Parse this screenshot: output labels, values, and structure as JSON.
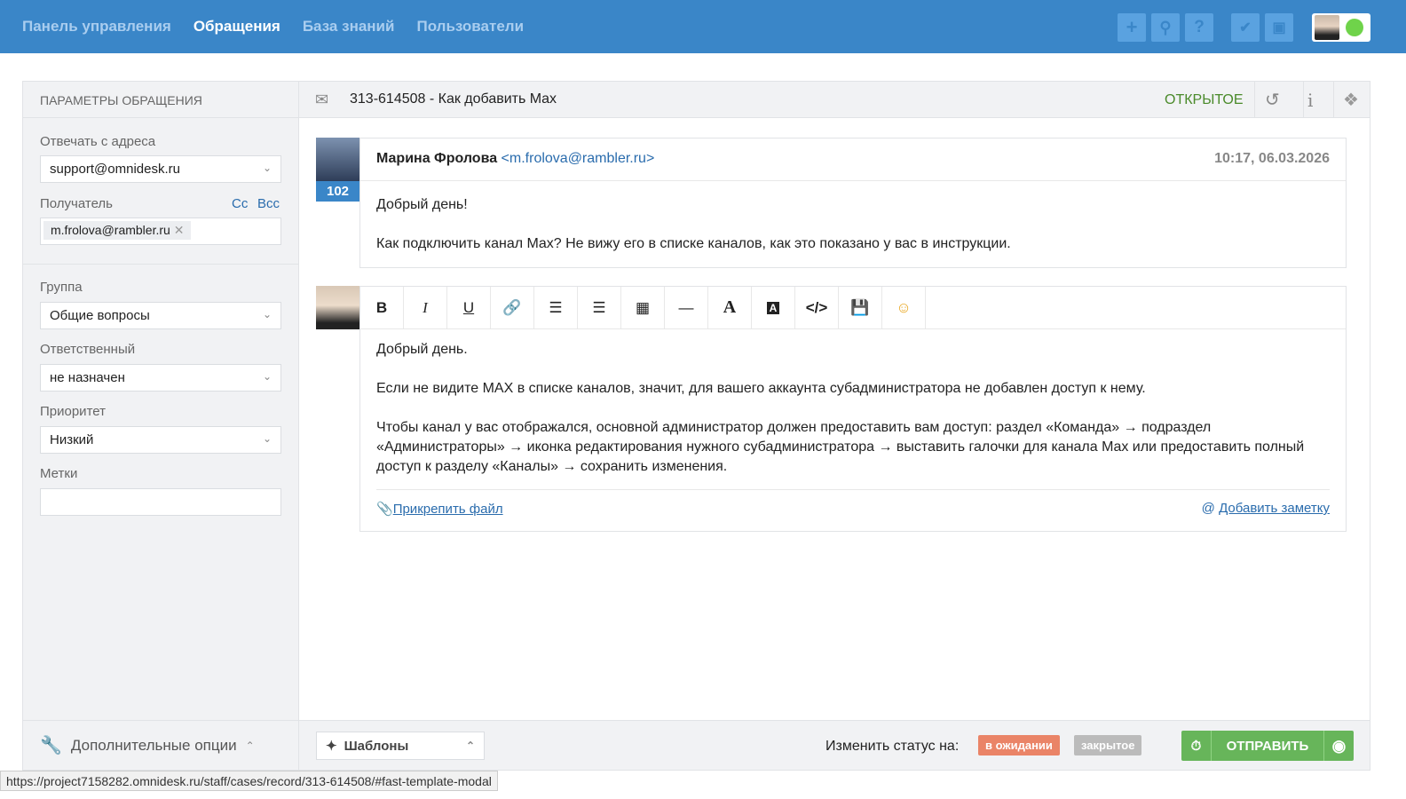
{
  "nav": [
    "Панель управления",
    "Обращения",
    "База знаний",
    "Пользователи"
  ],
  "sidebar": {
    "title": "ПАРАМЕТРЫ ОБРАЩЕНИЯ",
    "from_label": "Отвечать с адреса",
    "from_value": "support@omnidesk.ru",
    "recipient_label": "Получатель",
    "cc": "Cc",
    "bcc": "Bcc",
    "recipient_tag": "m.frolova@rambler.ru",
    "group_label": "Группа",
    "group_value": "Общие вопросы",
    "assignee_label": "Ответственный",
    "assignee_value": "не назначен",
    "priority_label": "Приоритет",
    "priority_value": "Низкий",
    "tags_label": "Метки",
    "more_options": "Дополнительные опции"
  },
  "ticket": {
    "subject": "313-614508 - Как добавить Max",
    "status": "ОТКРЫТОЕ"
  },
  "message": {
    "author": "Марина Фролова",
    "email": "<m.frolova@rambler.ru>",
    "time": "10:17, 06.03.2026",
    "count": "102",
    "lines": [
      "Добрый день!",
      "Как подключить канал Max? Не вижу его в списке каналов, как это показано у вас в инструкции."
    ]
  },
  "reply": {
    "lines": [
      "Добрый день.",
      "Если не видите MAX в списке каналов, значит, для вашего аккаунта субадминистратора не добавлен доступ к нему.",
      "Чтобы канал у вас отображался, основной администратор должен предоставить вам доступ: раздел «Команда» → подраздел «Администраторы» → иконка редактирования нужного субадминистратора → выставить галочки для канала Max или предоставить полный доступ к разделу «Каналы» → сохранить изменения."
    ],
    "attach": "Прикрепить файл",
    "note": "Добавить заметку"
  },
  "bottom": {
    "templates": "Шаблоны",
    "change_status": "Изменить статус на:",
    "pending": "в ожидании",
    "closed": "закрытое",
    "send": "ОТПРАВИТЬ"
  },
  "statusbar": "https://project7158282.omnidesk.ru/staff/cases/record/313-614508/#fast-template-modal"
}
